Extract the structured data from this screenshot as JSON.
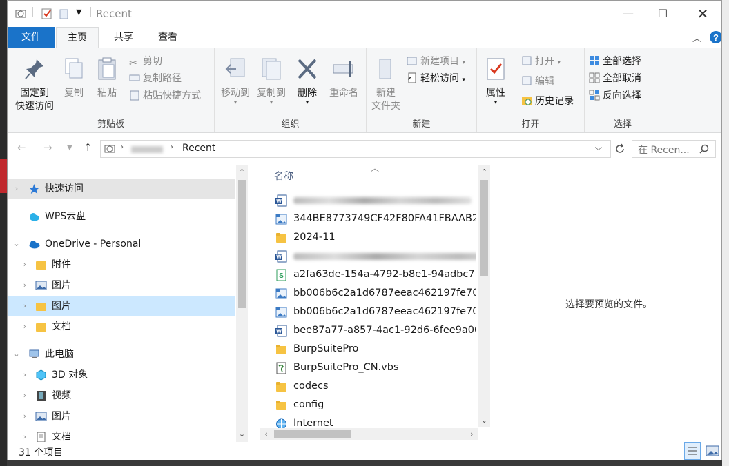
{
  "window": {
    "title": "Recent"
  },
  "tabs": {
    "file": "文件",
    "home": "主页",
    "share": "共享",
    "view": "查看"
  },
  "ribbon": {
    "clipboard": {
      "label": "剪贴板",
      "pin": "固定到\n快速访问",
      "copy": "复制",
      "paste": "粘贴",
      "cut": "剪切",
      "copy_path": "复制路径",
      "paste_shortcut": "粘贴快捷方式"
    },
    "organize": {
      "label": "组织",
      "move_to": "移动到",
      "copy_to": "复制到",
      "delete": "删除",
      "rename": "重命名"
    },
    "new": {
      "label": "新建",
      "new_folder": "新建\n文件夹",
      "new_item": "新建项目",
      "easy_access": "轻松访问"
    },
    "open": {
      "label": "打开",
      "properties": "属性",
      "open": "打开",
      "edit": "编辑",
      "history": "历史记录"
    },
    "select": {
      "label": "选择",
      "select_all": "全部选择",
      "select_none": "全部取消",
      "invert": "反向选择"
    }
  },
  "address": {
    "path": "Recent",
    "search_placeholder": "在 Recen..."
  },
  "nav": {
    "quick_access": "快速访问",
    "wps": "WPS云盘",
    "onedrive": "OneDrive - Personal",
    "od_attachments": "附件",
    "od_pictures1": "图片",
    "od_pictures2": "图片",
    "od_docs": "文档",
    "this_pc": "此电脑",
    "pc_3d": "3D 对象",
    "pc_video": "视频",
    "pc_pictures": "图片",
    "pc_docs": "文档"
  },
  "files": {
    "column_name": "名称",
    "items": [
      {
        "name": "",
        "icon": "word-icon"
      },
      {
        "name": "344BE8773749CF42F80FA41FBAAB2.",
        "icon": "image-file-icon"
      },
      {
        "name": "2024-11",
        "icon": "folder-icon"
      },
      {
        "name": "",
        "icon": "word-icon"
      },
      {
        "name": "a2fa63de-154a-4792-b8e1-94adbc7.",
        "icon": "spreadsheet-icon"
      },
      {
        "name": "bb006b6c2a1d6787eeac462197fe70.",
        "icon": "image-file-icon"
      },
      {
        "name": "bb006b6c2a1d6787eeac462197fe70.",
        "icon": "image-file-icon"
      },
      {
        "name": "bee87a77-a857-4ac1-92d6-6fee9a00",
        "icon": "word-icon"
      },
      {
        "name": "BurpSuitePro",
        "icon": "folder-icon"
      },
      {
        "name": "BurpSuitePro_CN.vbs",
        "icon": "script-icon"
      },
      {
        "name": "codecs",
        "icon": "folder-icon"
      },
      {
        "name": "config",
        "icon": "folder-icon"
      },
      {
        "name": "Internet",
        "icon": "internet-icon"
      }
    ]
  },
  "preview": {
    "message": "选择要预览的文件。"
  },
  "status": {
    "count": "31 个项目"
  },
  "colors": {
    "accent": "#1a73c9",
    "selected": "#cce8ff",
    "folder": "#f6c343"
  }
}
